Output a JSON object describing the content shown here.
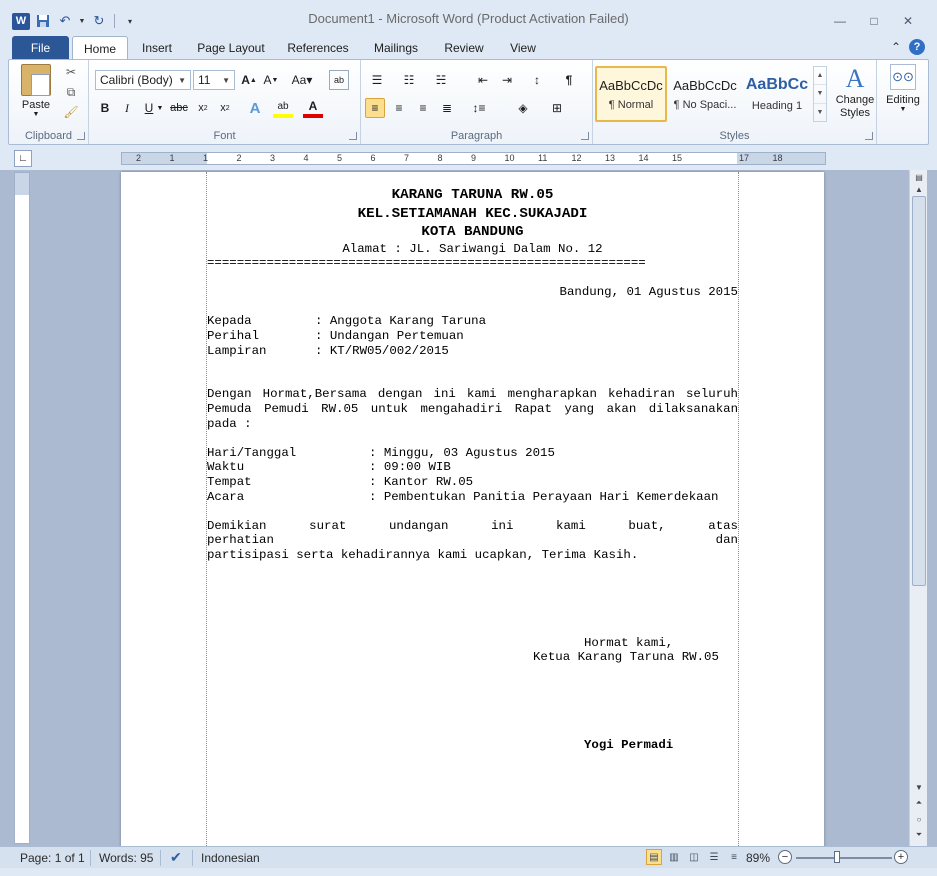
{
  "window": {
    "title": "Document1 - Microsoft Word (Product Activation Failed)",
    "app_logo": "W"
  },
  "tabs": [
    "File",
    "Home",
    "Insert",
    "Page Layout",
    "References",
    "Mailings",
    "Review",
    "View"
  ],
  "ribbon": {
    "clipboard": {
      "label": "Clipboard",
      "paste": "Paste"
    },
    "font": {
      "label": "Font",
      "family": "Calibri (Body)",
      "size": "11"
    },
    "paragraph": {
      "label": "Paragraph"
    },
    "styles": {
      "label": "Styles",
      "items": [
        {
          "sample": "AaBbCcDc",
          "name": "¶ Normal"
        },
        {
          "sample": "AaBbCcDc",
          "name": "¶ No Spaci..."
        },
        {
          "sample": "AaBbCc",
          "name": "Heading 1"
        }
      ],
      "change_styles": "Change Styles",
      "change_styles_sample": "A"
    },
    "editing": {
      "label": "Editing"
    }
  },
  "ruler": {
    "marks": [
      "2",
      "1",
      "1",
      "2",
      "3",
      "4",
      "5",
      "6",
      "7",
      "8",
      "9",
      "10",
      "11",
      "12",
      "13",
      "14",
      "15",
      "17",
      "18"
    ]
  },
  "document": {
    "heading1": "KARANG TARUNA RW.05",
    "heading2": "KEL.SETIAMANAH KEC.SUKAJADI",
    "heading3": "KOTA BANDUNG",
    "address": "Alamat : JL. Sariwangi Dalam No. 12",
    "separator": "===========================================================",
    "place_date": "Bandung, 01 Agustus 2015",
    "fields1": [
      {
        "label": "Kepada",
        "value": ": Anggota Karang Taruna"
      },
      {
        "label": "Perihal",
        "value": ": Undangan Pertemuan"
      },
      {
        "label": "Lampiran",
        "value": ": KT/RW05/002/2015"
      }
    ],
    "body_line1": "Dengan Hormat,Bersama dengan ini kami mengharapkan kehadiran seluruh",
    "body_line2": "Pemuda Pemudi RW.05 untuk mengahadiri Rapat yang akan dilaksanakan",
    "body_line3": "pada :",
    "fields2": [
      {
        "label": "Hari/Tanggal",
        "value": ": Minggu, 03 Agustus 2015"
      },
      {
        "label": "Waktu",
        "value": ": 09:00 WIB"
      },
      {
        "label": "Tempat",
        "value": ": Kantor RW.05"
      },
      {
        "label": "Acara",
        "value": ": Pembentukan Panitia Perayaan Hari Kemerdekaan"
      }
    ],
    "closing_line1": "Demikian surat undangan ini kami buat, atas perhatian dan",
    "closing_line2": "partisipasi serta kehadirannya kami ucapkan, Terima Kasih.",
    "regards": "Hormat kami,",
    "position": "Ketua Karang Taruna RW.05",
    "signer": "Yogi Permadi"
  },
  "status": {
    "page": "Page: 1 of 1",
    "words": "Words: 95",
    "language": "Indonesian",
    "zoom": "89%",
    "zoom_minus": "−",
    "zoom_plus": "+"
  }
}
